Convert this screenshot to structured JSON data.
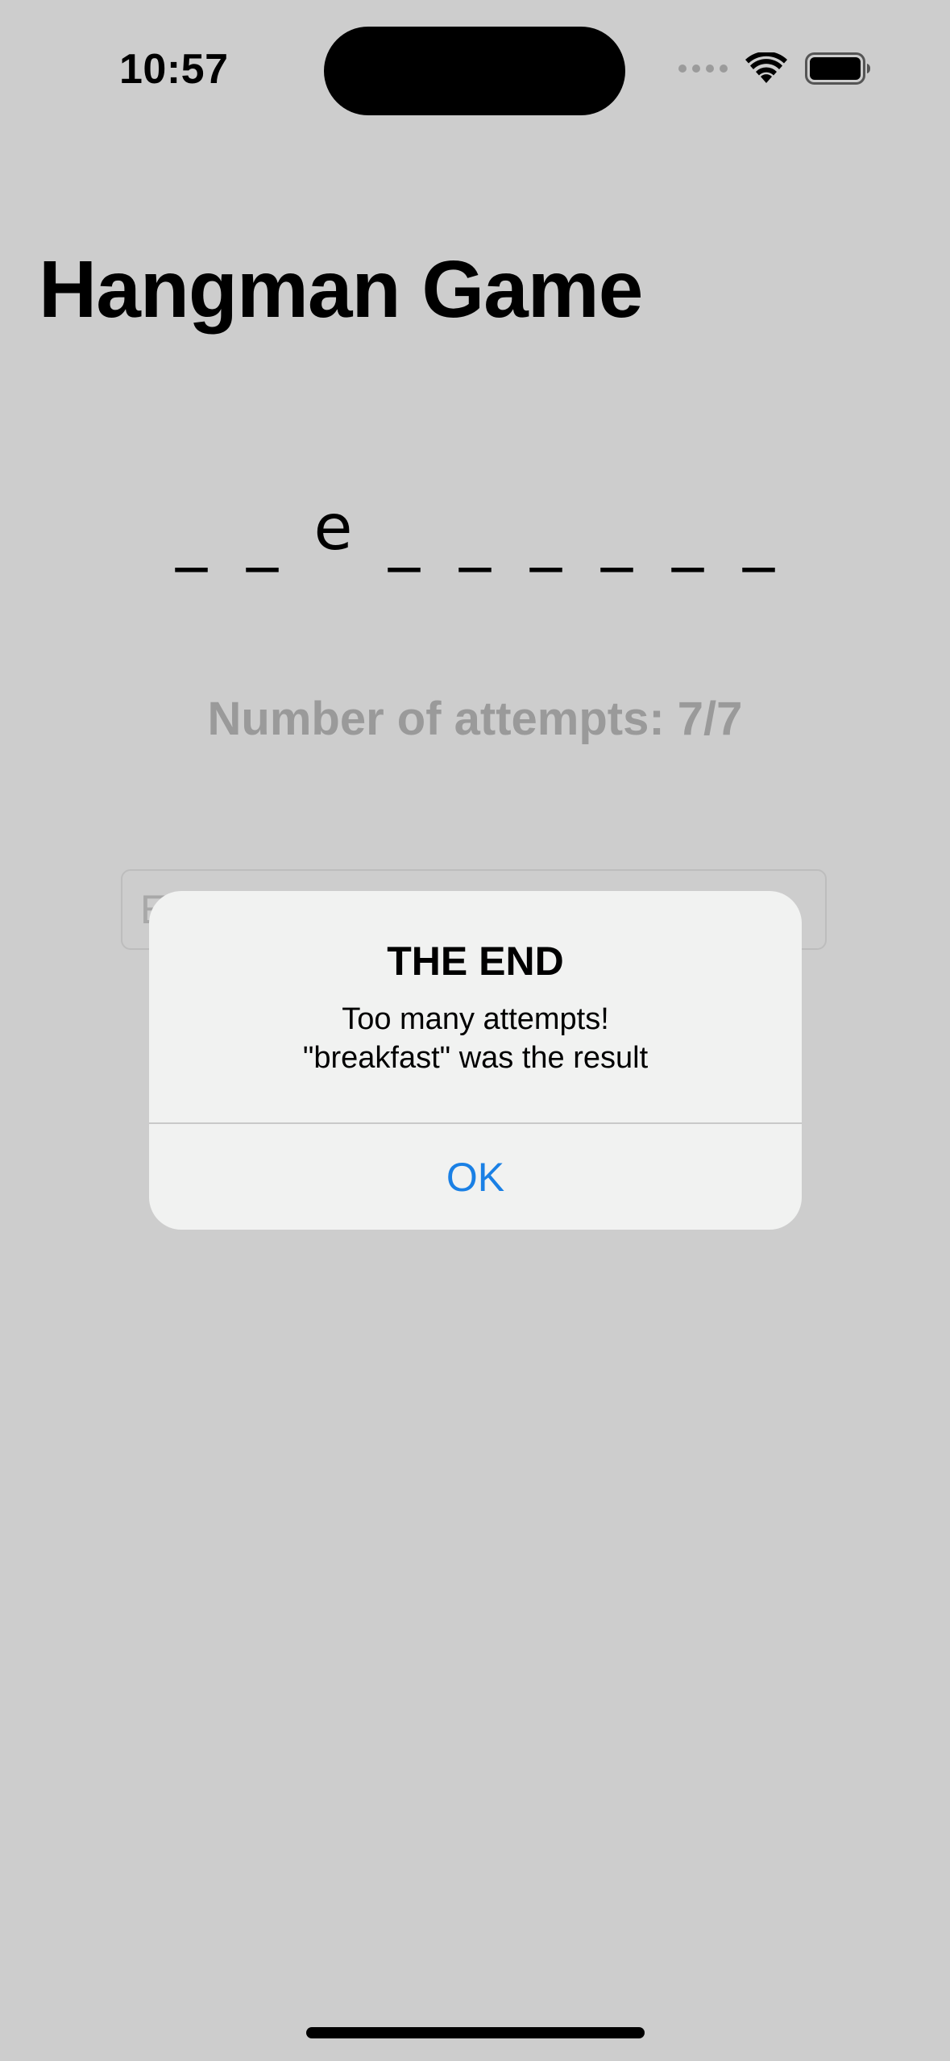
{
  "status_bar": {
    "time": "10:57",
    "icons": [
      "cellular-signal-icon",
      "wifi-icon",
      "battery-icon"
    ]
  },
  "title": "Hangman Game",
  "word": {
    "slots": [
      "_",
      "_",
      "e",
      "_",
      "_",
      "_",
      "_",
      "_",
      "_"
    ]
  },
  "attempts_text": "Number of attempts: 7/7",
  "attempts": {
    "used": 7,
    "max": 7
  },
  "text_field": {
    "visible_value": "E"
  },
  "alert": {
    "title": "THE END",
    "message_line1": "Too many attempts!",
    "message_line2": "\"breakfast\" was the result",
    "button_label": "OK"
  },
  "colors": {
    "background": "#cdcdcd",
    "alert_background": "#f1f2f1",
    "accent": "#1a80e5",
    "muted_text": "#9a9a9a"
  }
}
